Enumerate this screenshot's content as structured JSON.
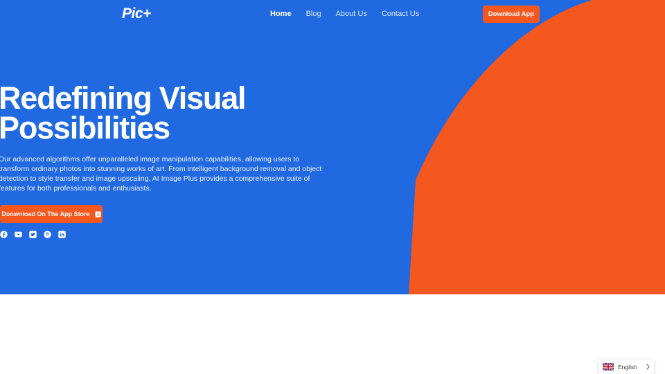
{
  "theme": {
    "brand_blue": "#2069e0",
    "accent_orange": "#f4581f",
    "text_white": "#ffffff",
    "page_background": "#ffffff"
  },
  "navbar": {
    "brand": "Pic+",
    "links": [
      {
        "label": "Home",
        "active": true
      },
      {
        "label": "Blog",
        "active": false
      },
      {
        "label": "About Us",
        "active": false
      },
      {
        "label": "Contact Us",
        "active": false
      }
    ],
    "cta": {
      "label": "Download App"
    }
  },
  "hero": {
    "heading": "Redefining Visual\nPossibilities",
    "paragraph": "Our advanced algorithms offer unparalleled image manipulation capabilities, allowing users to transform ordinary photos into stunning works of art. From intelligent background removal and object detection to style transfer and image upscaling, AI Image Plus provides a comprehensive suite of features for both professionals and enthusiasts.",
    "appstore_button": {
      "label": "Donwnload On The App Store",
      "icon": "app-store-icon"
    },
    "social": [
      {
        "name": "facebook-icon",
        "label": "Facebook"
      },
      {
        "name": "youtube-icon",
        "label": "YouTube"
      },
      {
        "name": "twitter-icon",
        "label": "Twitter"
      },
      {
        "name": "pinterest-icon",
        "label": "Pinterest"
      },
      {
        "name": "linkedin-icon",
        "label": "LinkedIn"
      }
    ],
    "shape": "orange-curve"
  },
  "language_widget": {
    "label": "English",
    "flag": "uk-flag-icon",
    "chevron": "chevron-right-icon"
  }
}
